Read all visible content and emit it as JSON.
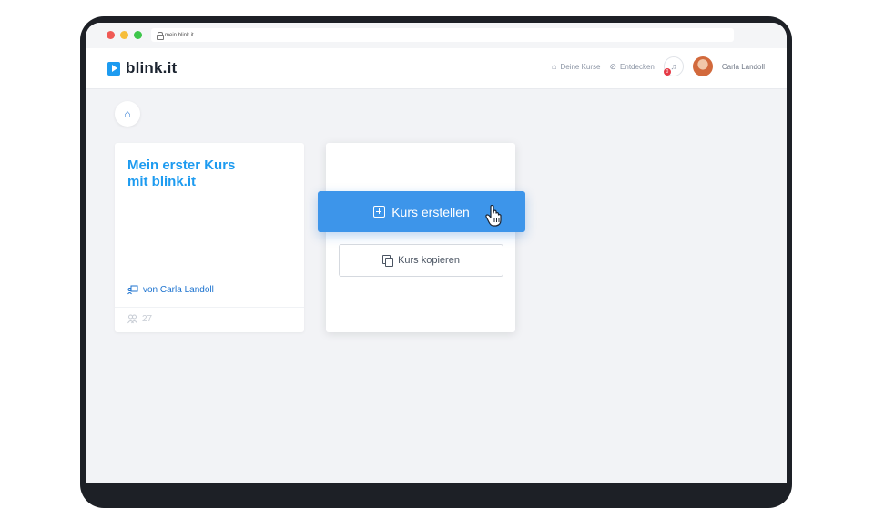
{
  "browser": {
    "url": "mein.blink.it"
  },
  "header": {
    "logo_text": "blink.it",
    "nav": [
      {
        "label": "Deine Kurse",
        "icon": "home-icon"
      },
      {
        "label": "Entdecken",
        "icon": "compass-icon"
      }
    ],
    "notification_count": "0",
    "user_name": "Carla Landoll"
  },
  "course_card": {
    "title_line1": "Mein erster Kurs",
    "title_line2": "mit blink.it",
    "author": "von Carla Landoll",
    "count": "27"
  },
  "actions": {
    "create_label": "Kurs erstellen",
    "copy_label": "Kurs kopieren"
  },
  "colors": {
    "brand": "#1d9bf0",
    "primary_button": "#3d95ea",
    "badge": "#e53945"
  }
}
